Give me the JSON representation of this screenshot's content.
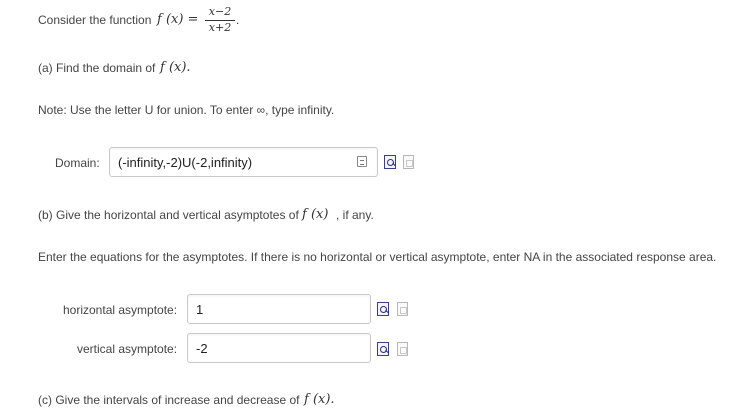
{
  "intro": {
    "prefix": "Consider the function",
    "function_lhs": "f (x) =",
    "numerator": "x−2",
    "denominator": "x+2",
    "suffix": "."
  },
  "part_a": {
    "prompt": "(a) Find the domain of",
    "prompt_math": "f (x).",
    "note": "Note: Use the letter U for union. To enter ∞, type infinity.",
    "domain_label": "Domain:",
    "domain_value": "(-infinity,-2)U(-2,infinity)"
  },
  "part_b": {
    "prompt": "(b) Give the horizontal and vertical asymptotes of",
    "prompt_math": "f (x)",
    "prompt_suffix": ", if any.",
    "instructions": "Enter the equations for the asymptotes. If there is no horizontal or vertical asymptote, enter NA in the associated response area.",
    "horizontal_label": "horizontal asymptote:",
    "horizontal_value": "1",
    "vertical_label": "vertical asymptote:",
    "vertical_value": "-2"
  },
  "part_c": {
    "prompt": "(c) Give the intervals of increase and decrease of",
    "prompt_math": "f (x)."
  },
  "icons": {
    "keyboard": "keyboard-icon",
    "view": "view-icon",
    "pdf": "pdf-icon"
  }
}
